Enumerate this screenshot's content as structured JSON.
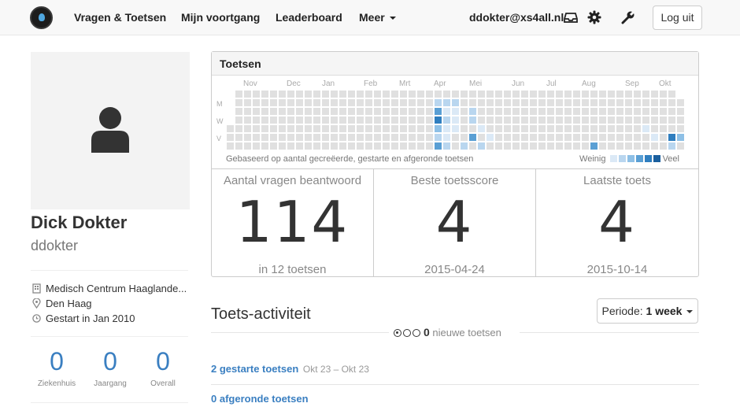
{
  "nav": {
    "logo_icon": "app-logo-icon",
    "items": [
      {
        "label": "Vragen & Toetsen"
      },
      {
        "label": "Mijn voortgang"
      },
      {
        "label": "Leaderboard"
      },
      {
        "label": "Meer"
      }
    ],
    "email": "ddokter@xs4all.nl",
    "icons": [
      "inbox-icon",
      "gear-icon",
      "wrench-icon"
    ],
    "logout_label": "Log uit"
  },
  "profile": {
    "name": "Dick Dokter",
    "username": "ddokter",
    "info": [
      {
        "icon": "building-icon",
        "text": "Medisch Centrum Haaglande..."
      },
      {
        "icon": "map-marker-icon",
        "text": "Den Haag"
      },
      {
        "icon": "clock-icon",
        "text": "Gestart in Jan 2010"
      }
    ],
    "stats": [
      {
        "value": "0",
        "label": "Ziekenhuis"
      },
      {
        "value": "0",
        "label": "Jaargang"
      },
      {
        "value": "0",
        "label": "Overall"
      }
    ]
  },
  "toetsen": {
    "title": "Toetsen",
    "months": [
      "Nov",
      "Dec",
      "Jan",
      "Feb",
      "Mrt",
      "Apr",
      "Mei",
      "Jun",
      "Jul",
      "Aug",
      "Sep",
      "Okt"
    ],
    "days": [
      "M",
      "W",
      "V"
    ],
    "footnote": "Gebaseerd op aantal gecreëerde, gestarte en afgeronde toetsen",
    "legend_low": "Weinig",
    "legend_high": "Veel",
    "colors": [
      "#e0e0e0",
      "#dbe9f6",
      "#b9d6ef",
      "#8ec0e6",
      "#5a9fd4",
      "#2f7ebf",
      "#1b5f9e"
    ],
    "stats": [
      {
        "title": "Aantal vragen beantwoord",
        "value": "114",
        "sub": "in 12 toetsen"
      },
      {
        "title": "Beste toetsscore",
        "value": "4",
        "sub": "2015-04-24"
      },
      {
        "title": "Laatste toets",
        "value": "4",
        "sub": "2015-10-14"
      }
    ]
  },
  "activity": {
    "title": "Toets-activiteit",
    "periode_label": "Periode:",
    "periode_value": "1 week",
    "new_count": "0",
    "new_label": "nieuwe toetsen",
    "items": [
      {
        "link": "2 gestarte toetsen",
        "date": "Okt 23 – Okt 23"
      },
      {
        "link": "0 afgeronde toetsen",
        "date": ""
      }
    ]
  }
}
